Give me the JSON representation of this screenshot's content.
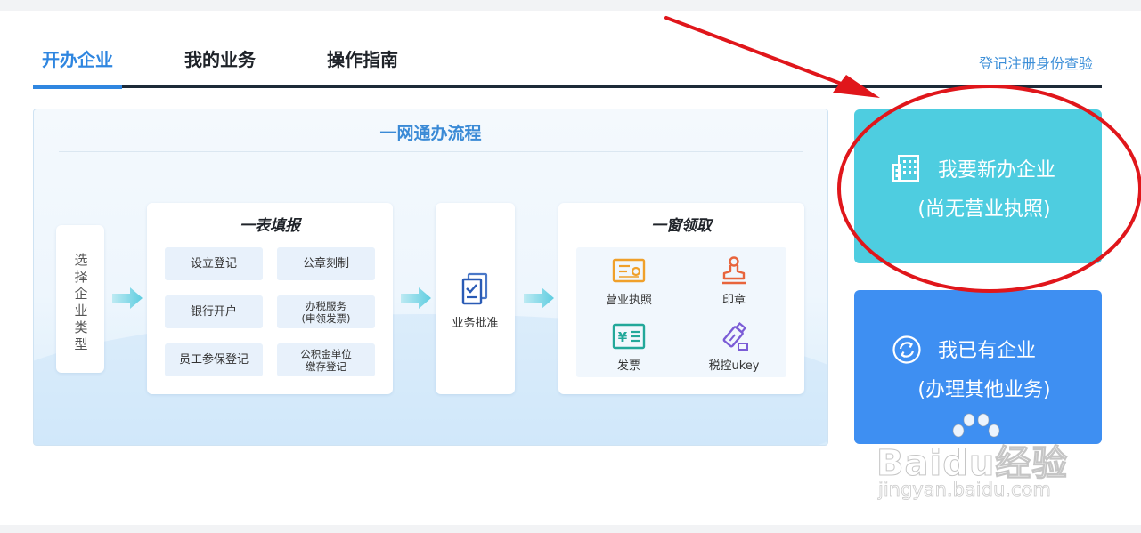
{
  "tabs": [
    {
      "label": "开办企业",
      "active": true
    },
    {
      "label": "我的业务",
      "active": false
    },
    {
      "label": "操作指南",
      "active": false
    }
  ],
  "verify_link": "登记注册身份查验",
  "flow": {
    "title": "一网通办流程",
    "select_step": "选择企业类型",
    "form_card": {
      "title": "一表填报",
      "items": [
        {
          "line1": "设立登记",
          "line2": ""
        },
        {
          "line1": "公章刻制",
          "line2": ""
        },
        {
          "line1": "银行开户",
          "line2": ""
        },
        {
          "line1": "办税服务",
          "line2": "(申领发票)"
        },
        {
          "line1": "员工参保登记",
          "line2": ""
        },
        {
          "line1": "公积金单位",
          "line2": "缴存登记"
        }
      ]
    },
    "approve_card": {
      "label": "业务批准",
      "icon": "document-check-icon"
    },
    "collect_card": {
      "title": "一窗领取",
      "items": [
        {
          "label": "营业执照",
          "icon": "business-license-icon",
          "color": "#f0a02a"
        },
        {
          "label": "印章",
          "icon": "seal-stamp-icon",
          "color": "#e8643c"
        },
        {
          "label": "发票",
          "icon": "invoice-icon",
          "color": "#23a89a"
        },
        {
          "label": "税控ukey",
          "icon": "usb-key-icon",
          "color": "#7b5cd6"
        }
      ]
    }
  },
  "actions": {
    "new_company": {
      "title": "我要新办企业",
      "subtitle": "(尚无营业执照)",
      "icon": "building-icon",
      "color": "#4ecde0"
    },
    "existing_company": {
      "title": "我已有企业",
      "subtitle": "(办理其他业务)",
      "icon": "circular-arrows-icon",
      "color": "#3e8ff2"
    }
  },
  "annotation": {
    "color": "#e0161b"
  },
  "watermark": {
    "main": "Baidu经验",
    "sub": "jingyan.baidu.com"
  },
  "colors": {
    "accent": "#2f86e0",
    "tab_underline": "#1d2a38"
  }
}
